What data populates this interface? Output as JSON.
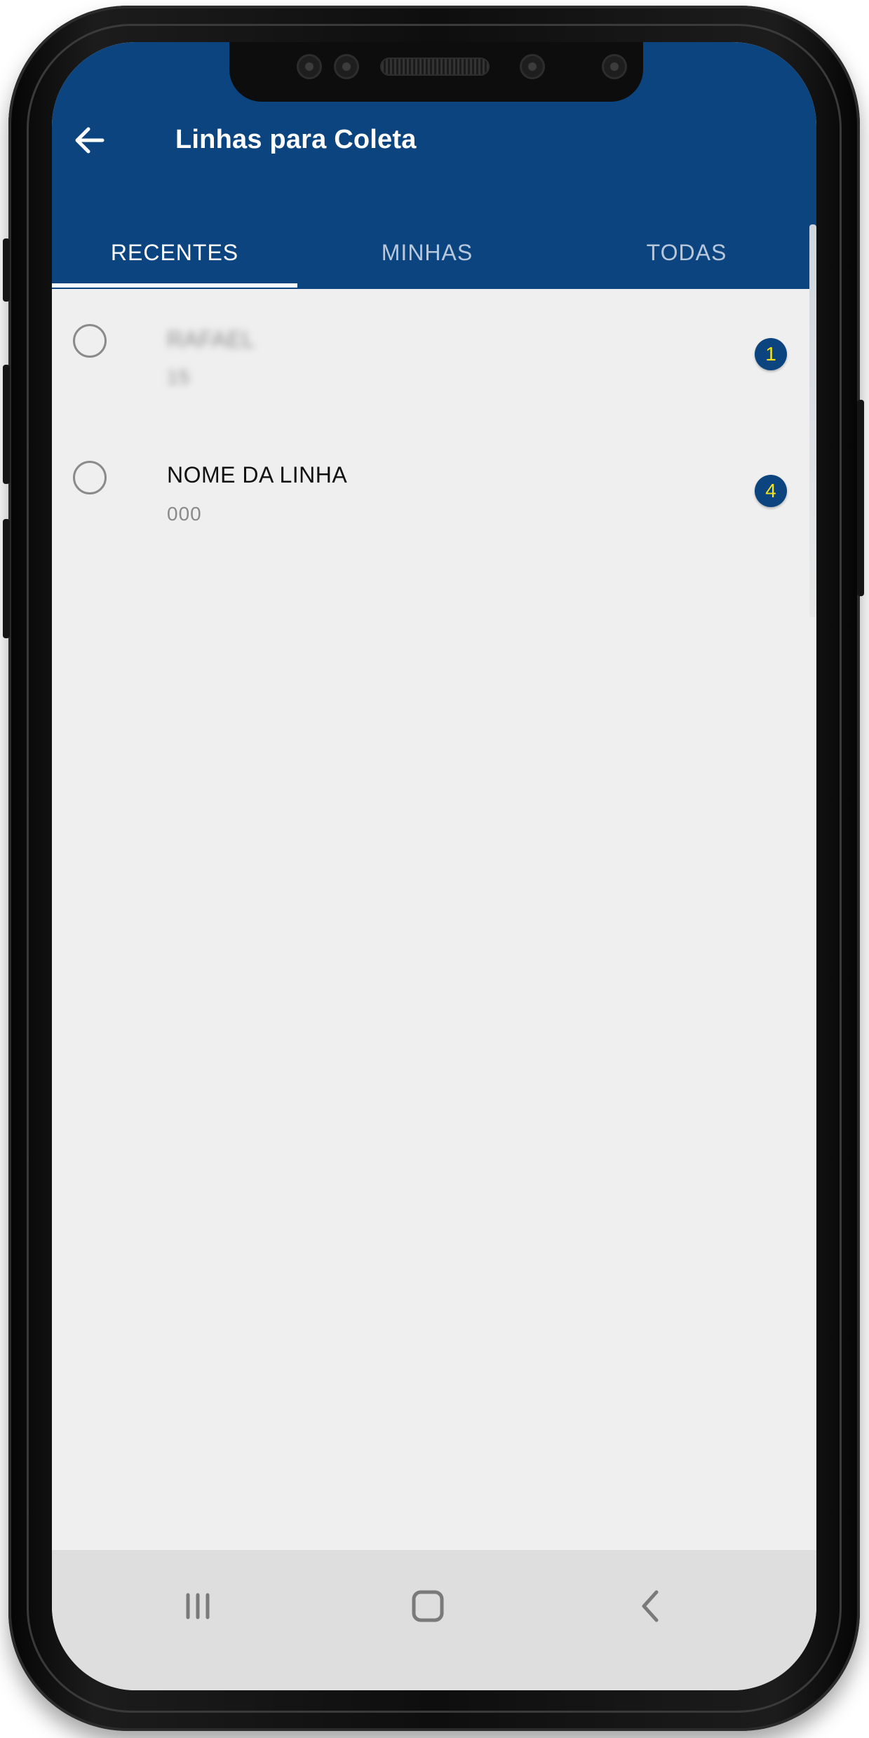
{
  "appbar": {
    "title": "Linhas para Coleta",
    "back_icon": "arrow-left-icon",
    "color": "#0b447e"
  },
  "tabs": [
    {
      "label": "RECENTES",
      "active": true
    },
    {
      "label": "MINHAS",
      "active": false
    },
    {
      "label": "TODAS",
      "active": false
    }
  ],
  "list": {
    "items": [
      {
        "title": "RAFAEL",
        "subtitle": "15",
        "badge": "1",
        "blurred": true,
        "selected": false
      },
      {
        "title": "NOME DA LINHA",
        "subtitle": "000",
        "badge": "4",
        "blurred": false,
        "selected": false
      }
    ]
  },
  "colors": {
    "primary": "#0b447e",
    "badge_text": "#f5e21a",
    "background": "#efefef"
  },
  "navbar": {
    "icons": [
      "recent-apps-icon",
      "home-icon",
      "back-nav-icon"
    ]
  }
}
